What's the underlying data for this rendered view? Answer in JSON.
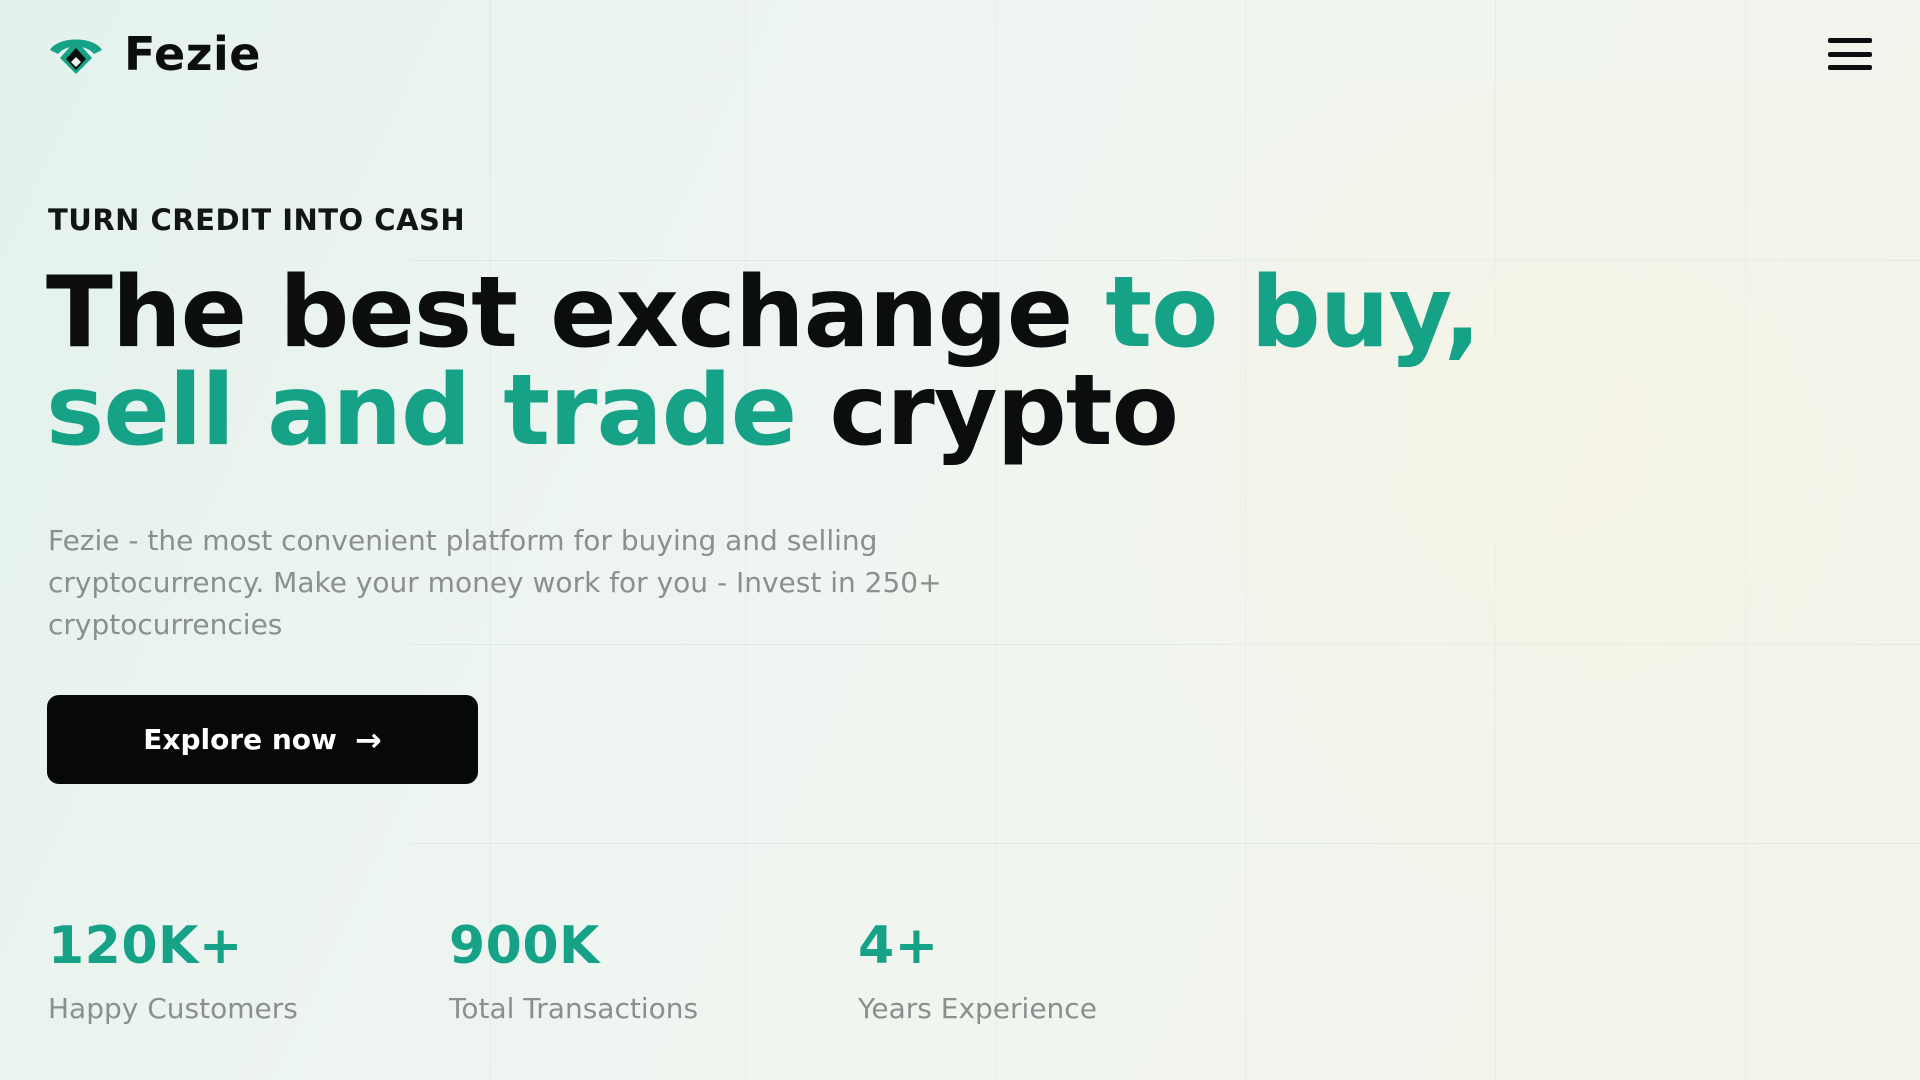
{
  "brand": {
    "name": "Fezie",
    "logo_icon": "fezie-logo-icon",
    "accent_color": "#16a286"
  },
  "header": {
    "menu_icon": "hamburger-menu-icon"
  },
  "hero": {
    "eyebrow": "TURN CREDIT INTO CASH",
    "headline": {
      "part1": "The best exchange ",
      "part2_accent": "to buy,",
      "part3_accent": "sell and trade",
      "part4": " crypto"
    },
    "description": "Fezie - the most convenient platform for buying and selling cryptocurrency. Make your money work for you - Invest in 250+ cryptocurrencies",
    "cta": {
      "label": "Explore now",
      "icon": "arrow-right-icon",
      "arrow_glyph": "→"
    }
  },
  "stats": [
    {
      "value": "120K+",
      "label": "Happy Customers"
    },
    {
      "value": "900K",
      "label": "Total Transactions"
    },
    {
      "value": "4+",
      "label": "Years Experience"
    }
  ]
}
